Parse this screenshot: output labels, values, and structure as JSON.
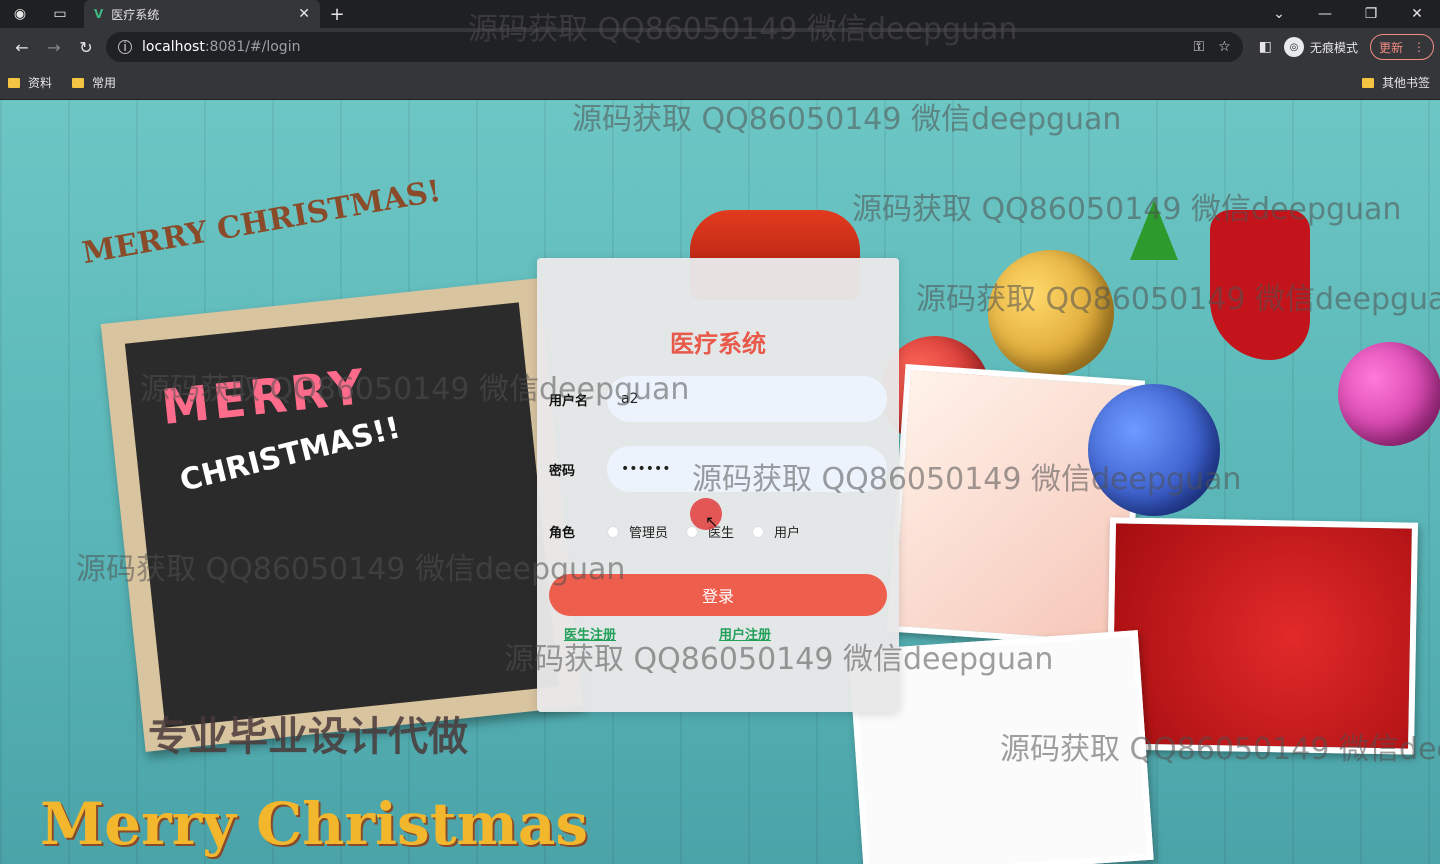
{
  "browser": {
    "tab_title": "医疗系统",
    "tab_close": "✕",
    "new_tab": "+",
    "url_host": "localhost",
    "url_rest": ":8081/#/login",
    "incognito_label": "无痕模式",
    "update_label": "更新",
    "bookmarks": [
      "资料",
      "常用"
    ],
    "other_bookmarks": "其他书签"
  },
  "login": {
    "title": "医疗系统",
    "username_label": "用户名",
    "username_value": "a2",
    "password_label": "密码",
    "password_value": "••••••",
    "role_label": "角色",
    "roles": [
      "管理员",
      "医生",
      "用户"
    ],
    "submit_label": "登录",
    "register_doctor": "医生注册",
    "register_user": "用户注册"
  },
  "background": {
    "merry_top": "MERRY CHRISTMAS!",
    "chalk_merry": "MERRY",
    "chalk_christmas": "CHRISTMAS!!",
    "bottom_text": "专业毕业设计代做",
    "merry_bottom": "Merry Christmas"
  },
  "watermark": "源码获取 QQ86050149 微信deepguan"
}
